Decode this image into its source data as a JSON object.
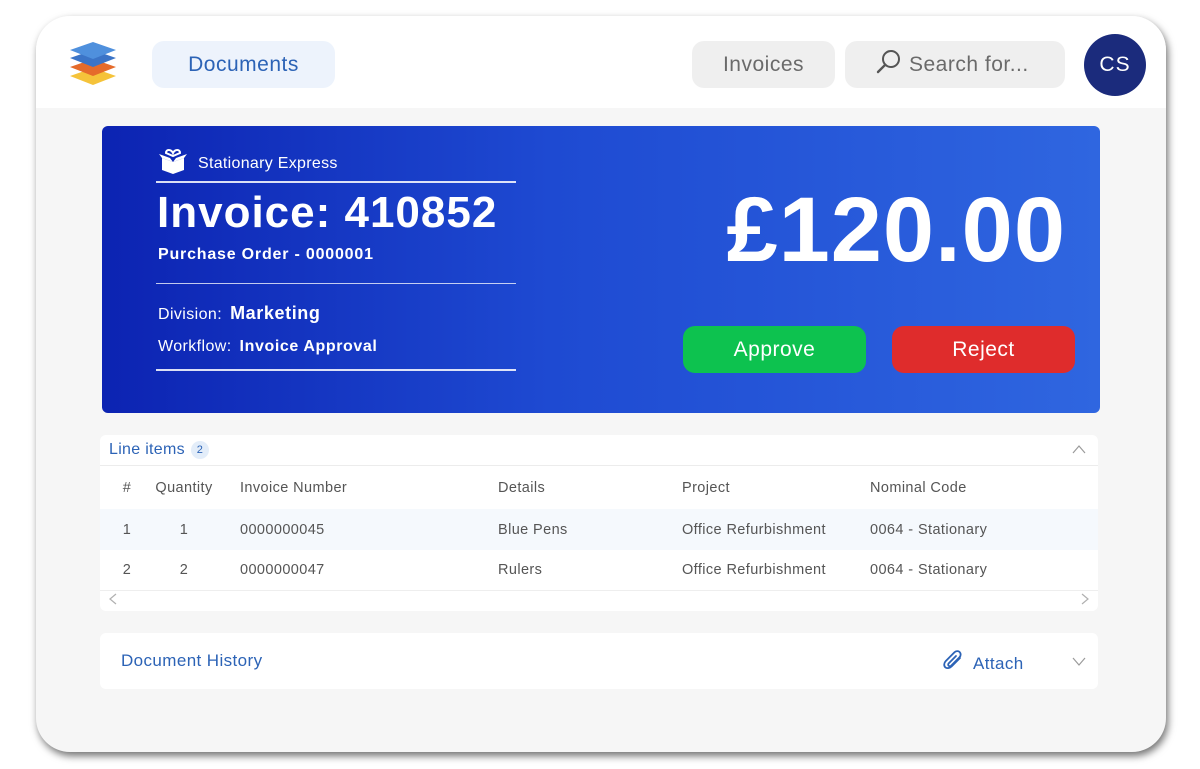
{
  "colors": {
    "brand_blue": "#2c63b6",
    "card_gradient_start": "#0c23b2",
    "card_gradient_end": "#2f66e0",
    "approve_green": "#0dc24f",
    "reject_red": "#df2c2c",
    "avatar_navy": "#1b2b7c"
  },
  "header": {
    "logo_icon": "stacked-layers-icon",
    "documents_label": "Documents",
    "invoices_label": "Invoices",
    "search_icon": "search-icon",
    "search_placeholder": "Search for...",
    "avatar_initials": "CS"
  },
  "invoice": {
    "supplier_icon": "open-box-icon",
    "supplier": "Stationary Express",
    "title": "Invoice: 410852",
    "purchase_order": "Purchase Order - 0000001",
    "division_label": "Division:",
    "division_value": "Marketing",
    "workflow_label": "Workflow:",
    "workflow_value": "Invoice Approval",
    "amount": "£120.00",
    "approve_label": "Approve",
    "reject_label": "Reject"
  },
  "line_items": {
    "title": "Line items",
    "count": "2",
    "columns": [
      "#",
      "Quantity",
      "Invoice Number",
      "Details",
      "Project",
      "Nominal Code"
    ],
    "rows": [
      [
        "1",
        "1",
        "0000000045",
        "Blue Pens",
        "Office Refurbishment",
        "0064 - Stationary"
      ],
      [
        "2",
        "2",
        "0000000047",
        "Rulers",
        "Office Refurbishment",
        "0064 - Stationary"
      ]
    ],
    "scroll_left": "<",
    "scroll_right": ">"
  },
  "history": {
    "title": "Document History",
    "attach_icon": "paperclip-icon",
    "attach_label": "Attach"
  }
}
